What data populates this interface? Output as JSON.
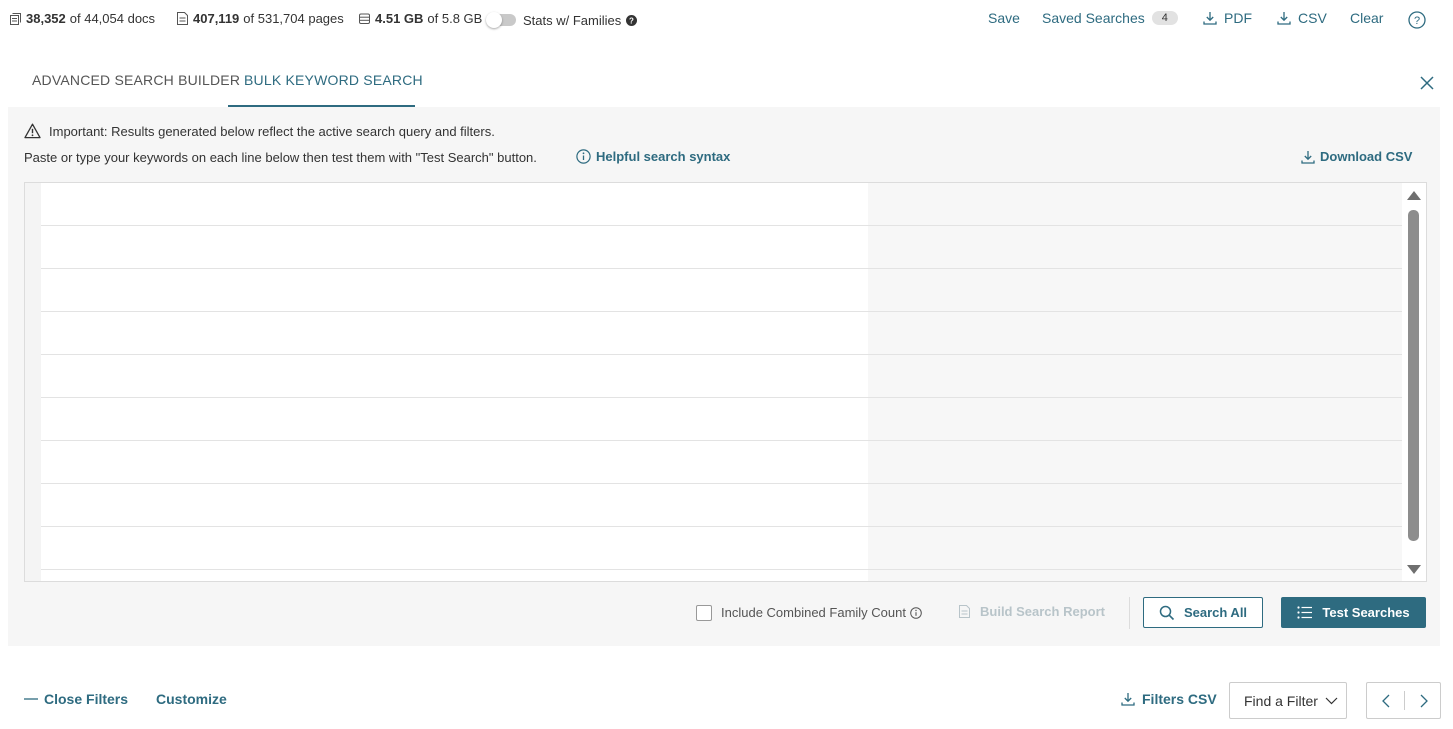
{
  "stats": {
    "docs": {
      "value": "38,352",
      "rest": "of 44,054 docs"
    },
    "pages": {
      "value": "407,119",
      "rest": "of 531,704 pages"
    },
    "size": {
      "value": "4.51 GB",
      "rest": "of 5.8 GB"
    },
    "families_toggle_label": "Stats w/ Families",
    "families_toggle_on": false
  },
  "toolbar": {
    "save_label": "Save",
    "saved_searches_label": "Saved Searches",
    "saved_searches_count": "4",
    "pdf_label": "PDF",
    "csv_label": "CSV",
    "clear_label": "Clear"
  },
  "tabs": [
    {
      "label": "ADVANCED SEARCH BUILDER",
      "active": false
    },
    {
      "label": "BULK KEYWORD SEARCH",
      "active": true
    }
  ],
  "panel": {
    "important_text": "Important: Results generated below reflect the active search query and filters.",
    "instruction_text": "Paste or type your keywords on each line below then test them with \"Test Search\" button.",
    "helpful_syntax_label": "Helpful search syntax",
    "download_csv_label": "Download CSV",
    "include_family_label": "Include Combined Family Count",
    "include_family_checked": false,
    "build_report_label": "Build Search Report",
    "search_all_label": "Search All",
    "test_searches_label": "Test Searches"
  },
  "footer": {
    "close_filters_label": "Close Filters",
    "customize_label": "Customize",
    "filters_csv_label": "Filters CSV",
    "find_filter_label": "Find a Filter"
  },
  "colors": {
    "accent": "#2e6b80",
    "panel_bg": "#f6f6f6",
    "disabled_text": "#b8c4c9"
  }
}
